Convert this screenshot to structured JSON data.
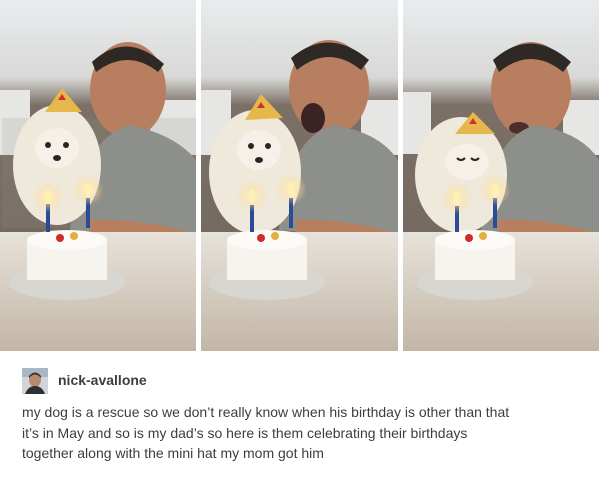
{
  "post": {
    "username": "nick-avallone",
    "caption_lines": [
      "my dog is a rescue so we don’t really know when his birthday is other than that",
      "it’s in May and so is my dad’s so here is them celebrating their birthdays",
      "together along with the mini hat my mom got him"
    ]
  },
  "photos": [
    {
      "frame": "dad-smiling"
    },
    {
      "frame": "dad-blowing"
    },
    {
      "frame": "dad-blowing-dog-looking-down"
    }
  ],
  "colors": {
    "wall": "#7b6f63",
    "window": "#e7e8e6",
    "table": "#d7cfc3",
    "shirt": "#8c8e8a",
    "dog": "#efe9dc",
    "hat": "#e6b84c",
    "candle_flame": "#fff2b0",
    "text": "#3d3d3d"
  }
}
